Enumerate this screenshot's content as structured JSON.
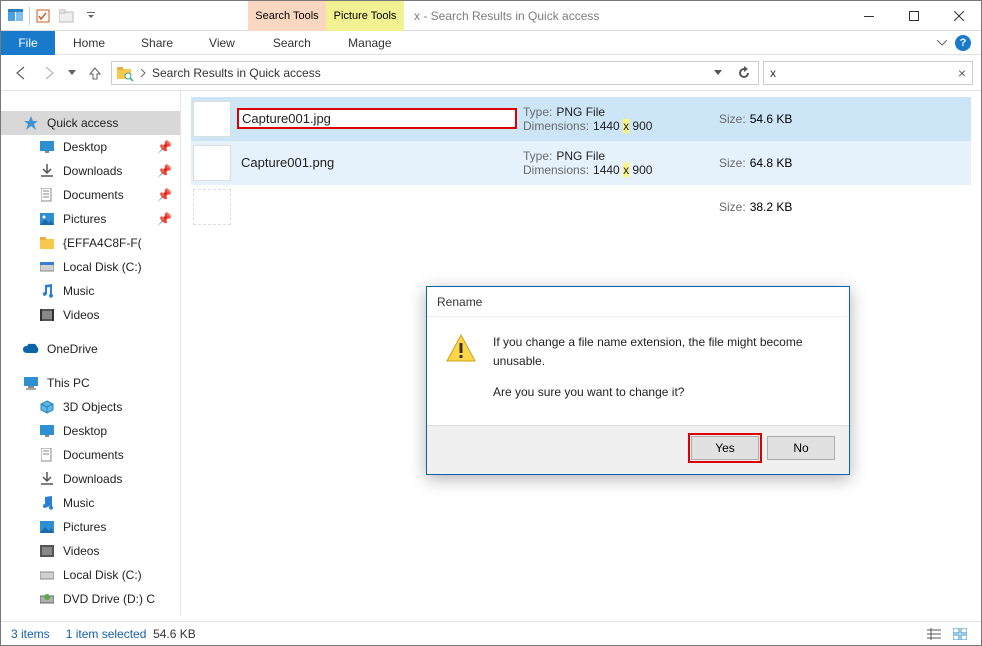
{
  "window": {
    "title": "x - Search Results in Quick access",
    "context_tabs": {
      "search": "Search Tools",
      "picture": "Picture Tools"
    }
  },
  "ribbon": {
    "file": "File",
    "tabs": [
      "Home",
      "Share",
      "View"
    ],
    "context": [
      "Search",
      "Manage"
    ]
  },
  "nav": {
    "breadcrumb": "Search Results in Quick access",
    "search_value": "x",
    "search_clear": "×"
  },
  "sidebar": {
    "quick_access": "Quick access",
    "quick_items": [
      {
        "label": "Desktop",
        "color": "#2f8fd3"
      },
      {
        "label": "Downloads",
        "color": "#555"
      },
      {
        "label": "Documents",
        "color": "#555"
      },
      {
        "label": "Pictures",
        "color": "#2f8fd3"
      },
      {
        "label": "{EFFA4C8F-F(",
        "color": "#f7c44e"
      },
      {
        "label": "Local Disk (C:)",
        "color": "#777"
      },
      {
        "label": "Music",
        "color": "#2a7fd4"
      },
      {
        "label": "Videos",
        "color": "#555"
      }
    ],
    "onedrive": "OneDrive",
    "this_pc": "This PC",
    "pc_items": [
      "3D Objects",
      "Desktop",
      "Documents",
      "Downloads",
      "Music",
      "Pictures",
      "Videos",
      "Local Disk (C:)",
      "DVD Drive (D:) C"
    ]
  },
  "results": [
    {
      "name": "Capture001.jpg",
      "type_k": "Type:",
      "type": "PNG File",
      "dim_k": "Dimensions:",
      "dim_pre": "1440",
      "dim_x": "x",
      "dim_post": "900",
      "size_k": "Size:",
      "size": "54.6 KB",
      "rename": true,
      "sel": true
    },
    {
      "name": "Capture001.png",
      "type_k": "Type:",
      "type": "PNG File",
      "dim_k": "Dimensions:",
      "dim_pre": "1440",
      "dim_x": "x",
      "dim_post": "900",
      "size_k": "Size:",
      "size": "64.8 KB",
      "rename": false,
      "sel": false
    },
    {
      "name": "",
      "type_k": "",
      "type": "",
      "dim_k": "",
      "dim_pre": "",
      "dim_x": "",
      "dim_post": "",
      "size_k": "Size:",
      "size": "38.2 KB",
      "rename": false,
      "sel": false
    }
  ],
  "dialog": {
    "title": "Rename",
    "line1": "If you change a file name extension, the file might become unusable.",
    "line2": "Are you sure you want to change it?",
    "yes": "Yes",
    "no": "No"
  },
  "status": {
    "count": "3 items",
    "selected": "1 item selected",
    "size": "54.6 KB"
  }
}
